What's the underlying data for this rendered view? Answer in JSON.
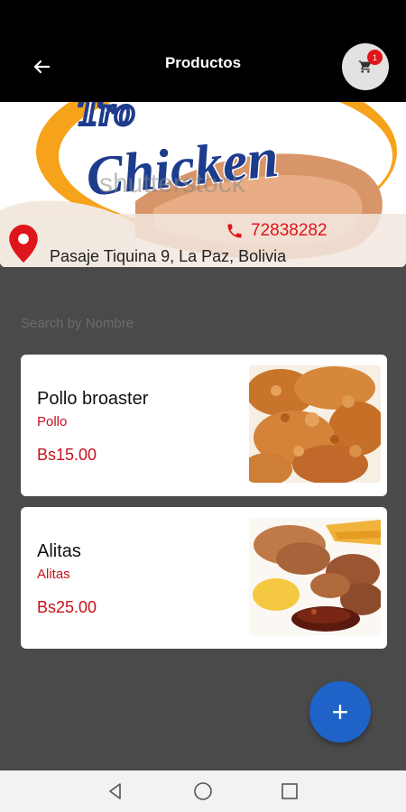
{
  "appbar": {
    "title": "Productos",
    "cart_count": "1"
  },
  "banner": {
    "logo_text": "Chicken",
    "watermark": "shutterstock",
    "phone": "72838282",
    "address": "Pasaje Tiquina 9, La Paz, Bolivia"
  },
  "search": {
    "placeholder": "Search by Nombre"
  },
  "products": [
    {
      "name": "Pollo broaster",
      "category": "Pollo",
      "price": "Bs15.00"
    },
    {
      "name": "Alitas",
      "category": "Alitas",
      "price": "Bs25.00"
    }
  ],
  "fab": {
    "label": "+"
  },
  "colors": {
    "appbar": "#000000",
    "background": "#4a4a4a",
    "accent_red": "#c8101c",
    "fab_blue": "#1f62c8"
  },
  "icons": [
    "back-arrow-icon",
    "cart-icon",
    "location-pin-icon",
    "phone-icon",
    "nav-back-icon",
    "nav-home-icon",
    "nav-recents-icon"
  ]
}
